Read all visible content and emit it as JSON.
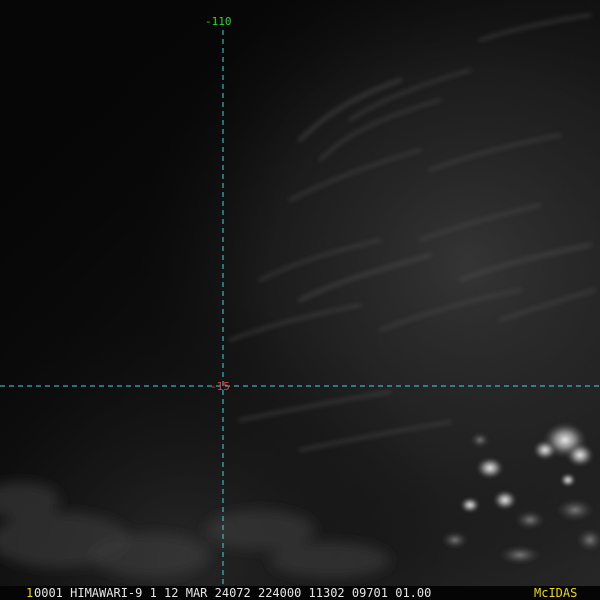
{
  "image": {
    "kind": "satellite-visible-imagery",
    "colors": {
      "background": "#050505",
      "grid_line": "#3fd6e6",
      "longitude_label": "#22dd22",
      "latitude_label": "#ff3333",
      "frame_number": "#f0d800",
      "header_text": "#e6e6e6",
      "mcidas_label": "#f0d800"
    }
  },
  "grid": {
    "longitude_label": "-110",
    "latitude_label": "-15"
  },
  "status_bar": {
    "frame_number": "1",
    "header_text": "0001 HIMAWARI-9  1 12 MAR 24072 224000 11302 09701 01.00",
    "mcidas_label": "McIDAS"
  }
}
